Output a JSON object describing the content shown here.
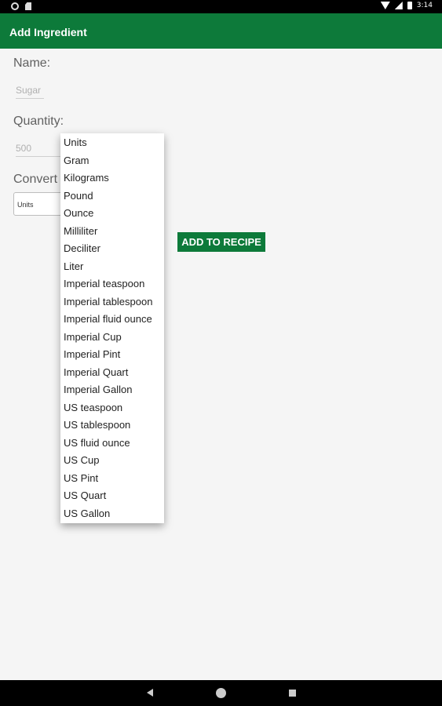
{
  "status_bar": {
    "time": "3:14"
  },
  "app_bar": {
    "title": "Add Ingredient"
  },
  "form": {
    "name_label": "Name:",
    "name_value": "Sugar",
    "quantity_label": "Quantity:",
    "quantity_value": "500",
    "convert_label": "Convert",
    "unit_selected": "Units",
    "add_button": "ADD TO RECIPE"
  },
  "dropdown": {
    "options": [
      "Units",
      "Gram",
      "Kilograms",
      "Pound",
      "Ounce",
      "Milliliter",
      "Deciliter",
      "Liter",
      "Imperial teaspoon",
      "Imperial tablespoon",
      "Imperial fluid ounce",
      "Imperial Cup",
      "Imperial Pint",
      "Imperial Quart",
      "Imperial Gallon",
      "US teaspoon",
      "US tablespoon",
      "US fluid ounce",
      "US Cup",
      "US Pint",
      "US Quart",
      "US Gallon"
    ]
  },
  "colors": {
    "primary": "#0d7a3a",
    "background": "#f5f5f5"
  }
}
